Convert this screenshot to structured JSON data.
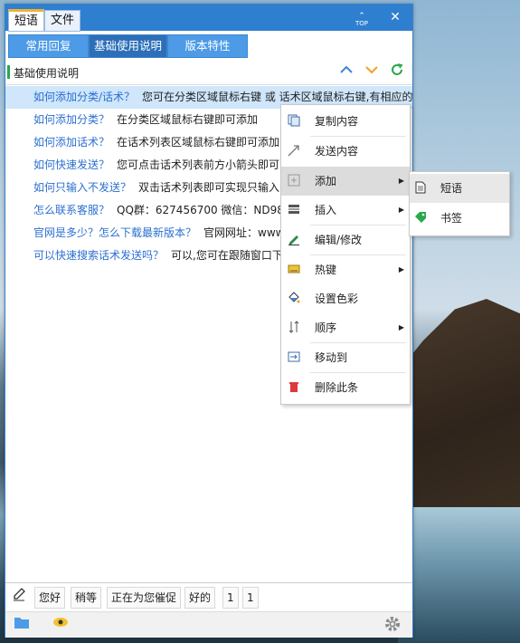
{
  "window": {
    "tabs": [
      {
        "label": "短语"
      },
      {
        "label": "文件"
      }
    ],
    "top_label": "TOP",
    "close_glyph": "✕"
  },
  "categories": [
    {
      "label": "常用回复"
    },
    {
      "label": "基础使用说明"
    },
    {
      "label": "版本特性"
    }
  ],
  "header": {
    "title": "基础使用说明"
  },
  "phrases": [
    {
      "q": "如何添加分类/话术？",
      "a": "您可在分类区域鼠标右键 或 话术区域鼠标右键,有相应的"
    },
    {
      "q": "如何添加分类？",
      "a": "在分类区域鼠标右键即可添加"
    },
    {
      "q": "如何添加话术？",
      "a": "在话术列表区域鼠标右键即可添加"
    },
    {
      "q": "如何快速发送？",
      "a": "您可点击话术列表前方小箭头即可"
    },
    {
      "q": "如何只输入不发送？",
      "a": "双击话术列表即可实现只输入"
    },
    {
      "q": "怎么联系客服？",
      "a": "QQ群：627456700 微信：ND980"
    },
    {
      "q": "官网是多少？怎么下载最新版本？",
      "a": "官网网址：www"
    },
    {
      "q": "可以快速搜索话术发送吗？",
      "a": "可以,您可在跟随窗口下"
    }
  ],
  "quick_chips": [
    {
      "label": "您好"
    },
    {
      "label": "稍等"
    },
    {
      "label": "正在为您催促"
    },
    {
      "label": "好的"
    },
    {
      "label": "1"
    },
    {
      "label": "1"
    }
  ],
  "context_menu": [
    {
      "label": "复制内容",
      "icon": "copy-icon"
    },
    {
      "label": "发送内容",
      "icon": "send-icon"
    },
    {
      "label": "添加",
      "icon": "add-icon",
      "submenu": true
    },
    {
      "label": "插入",
      "icon": "insert-icon",
      "submenu": true
    },
    {
      "label": "编辑/修改",
      "icon": "edit-icon"
    },
    {
      "label": "热键",
      "icon": "keyboard-icon",
      "submenu": true
    },
    {
      "label": "设置色彩",
      "icon": "paint-bucket-icon"
    },
    {
      "label": "顺序",
      "icon": "sort-icon",
      "submenu": true
    },
    {
      "label": "移动到",
      "icon": "move-icon"
    },
    {
      "label": "删除此条",
      "icon": "trash-icon"
    }
  ],
  "add_submenu": [
    {
      "label": "短语",
      "icon": "document-icon"
    },
    {
      "label": "书签",
      "icon": "tag-icon"
    }
  ],
  "colors": {
    "accent": "#2f7fd0",
    "link": "#2b6fd0",
    "selected_row": "#cfe6fb",
    "category": "#4d9be6"
  }
}
